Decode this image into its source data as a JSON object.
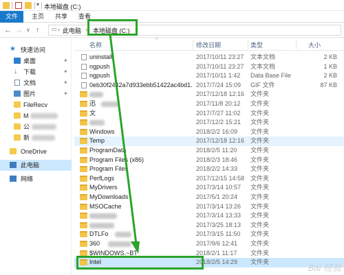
{
  "window": {
    "title": "本地磁盘 (C:)"
  },
  "ribbon": {
    "tabs": [
      "文件",
      "主页",
      "共享",
      "查看"
    ]
  },
  "address": {
    "crumbs": [
      "此电脑",
      "本地磁盘 (C:)"
    ]
  },
  "nav": {
    "items": [
      {
        "label": "快速访问"
      },
      {
        "label": "桌面"
      },
      {
        "label": "下载"
      },
      {
        "label": "文档"
      },
      {
        "label": "图片"
      },
      {
        "label": "FileRecv"
      },
      {
        "label": "M"
      },
      {
        "label": "公"
      },
      {
        "label": "新"
      },
      {
        "label": "OneDrive"
      },
      {
        "label": "此电脑"
      },
      {
        "label": "网络"
      }
    ]
  },
  "columns": {
    "name": "名称",
    "date": "修改日期",
    "type": "类型",
    "size": "大小"
  },
  "files": [
    {
      "name": "uninstall",
      "date": "2017/10/11 23:27",
      "type": "文本文档",
      "size": "2 KB",
      "kind": "file"
    },
    {
      "name": "ngpush",
      "date": "2017/10/11 23:27",
      "type": "文本文档",
      "size": "1 KB",
      "kind": "file"
    },
    {
      "name": "ngpush",
      "date": "2017/10/11 1:42",
      "type": "Data Base File",
      "size": "2 KB",
      "kind": "file"
    },
    {
      "name": "0eb30f2442a7d933ebb51422ac4bd1...",
      "date": "2017/7/24 15:09",
      "type": "GIF 文件",
      "size": "87 KB",
      "kind": "file"
    },
    {
      "name": "",
      "date": "2017/12/18 12:16",
      "type": "文件夹",
      "size": "",
      "kind": "folder"
    },
    {
      "name": "迅",
      "date": "2017/11/8 20:12",
      "type": "文件夹",
      "size": "",
      "kind": "folder"
    },
    {
      "name": "文",
      "date": "2017/7/27 11:02",
      "type": "文件夹",
      "size": "",
      "kind": "folder"
    },
    {
      "name": "",
      "date": "2017/12/2 15:21",
      "type": "文件夹",
      "size": "",
      "kind": "folder"
    },
    {
      "name": "Windows",
      "date": "2018/2/2 16:09",
      "type": "文件夹",
      "size": "",
      "kind": "folder"
    },
    {
      "name": "Temp",
      "date": "2017/12/18 12:16",
      "type": "文件夹",
      "size": "",
      "kind": "folder"
    },
    {
      "name": "ProgramData",
      "date": "2018/2/5 11:20",
      "type": "文件夹",
      "size": "",
      "kind": "folder"
    },
    {
      "name": "Program Files (x86)",
      "date": "2018/2/3 18:46",
      "type": "文件夹",
      "size": "",
      "kind": "folder"
    },
    {
      "name": "Program Files",
      "date": "2018/2/2 14:33",
      "type": "文件夹",
      "size": "",
      "kind": "folder"
    },
    {
      "name": "PerfLogs",
      "date": "2017/12/15 14:58",
      "type": "文件夹",
      "size": "",
      "kind": "folder"
    },
    {
      "name": "MyDrivers",
      "date": "2017/3/14 10:57",
      "type": "文件夹",
      "size": "",
      "kind": "folder"
    },
    {
      "name": "MyDownloads",
      "date": "2017/5/1 20:24",
      "type": "文件夹",
      "size": "",
      "kind": "folder"
    },
    {
      "name": "MSOCache",
      "date": "2017/3/14 13:26",
      "type": "文件夹",
      "size": "",
      "kind": "folder"
    },
    {
      "name": "",
      "date": "2017/3/14 13:33",
      "type": "文件夹",
      "size": "",
      "kind": "folder"
    },
    {
      "name": "",
      "date": "2017/3/25 18:13",
      "type": "文件夹",
      "size": "",
      "kind": "folder"
    },
    {
      "name": "DTLFo",
      "date": "2017/3/15 11:50",
      "type": "文件夹",
      "size": "",
      "kind": "folder"
    },
    {
      "name": "360",
      "date": "2017/9/6 12:41",
      "type": "文件夹",
      "size": "",
      "kind": "folder"
    },
    {
      "name": "$WINDOWS.~BT",
      "date": "2018/2/1 11:17",
      "type": "文件夹",
      "size": "",
      "kind": "folder"
    },
    {
      "name": "Intel",
      "date": "2018/2/5 14:29",
      "type": "文件夹",
      "size": "",
      "kind": "folder"
    }
  ],
  "colors": {
    "accent": "#1979ca",
    "highlight": "#2aa42a",
    "folder": "#f3c54a",
    "selection": "#cce8ff"
  },
  "watermark": "Bai 经验"
}
